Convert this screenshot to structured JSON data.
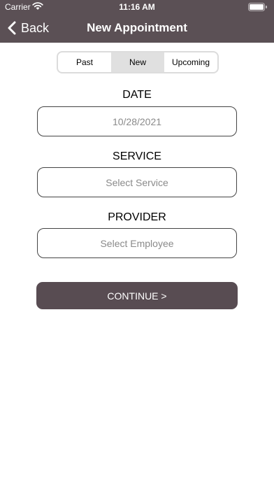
{
  "status_bar": {
    "carrier": "Carrier",
    "time": "11:16 AM"
  },
  "nav": {
    "back_label": "Back",
    "title": "New Appointment"
  },
  "tabs": [
    {
      "label": "Past",
      "selected": false
    },
    {
      "label": "New",
      "selected": true
    },
    {
      "label": "Upcoming",
      "selected": false
    }
  ],
  "form": {
    "date_label": "DATE",
    "date_value": "10/28/2021",
    "service_label": "SERVICE",
    "service_placeholder": "Select Service",
    "provider_label": "PROVIDER",
    "provider_placeholder": "Select Employee"
  },
  "continue_label": "CONTINUE >",
  "colors": {
    "header": "#5b5055",
    "button": "#584c52",
    "selected_tab": "#e0e0e0"
  },
  "icons": [
    "wifi-icon",
    "battery-icon",
    "back-chevron-icon"
  ]
}
